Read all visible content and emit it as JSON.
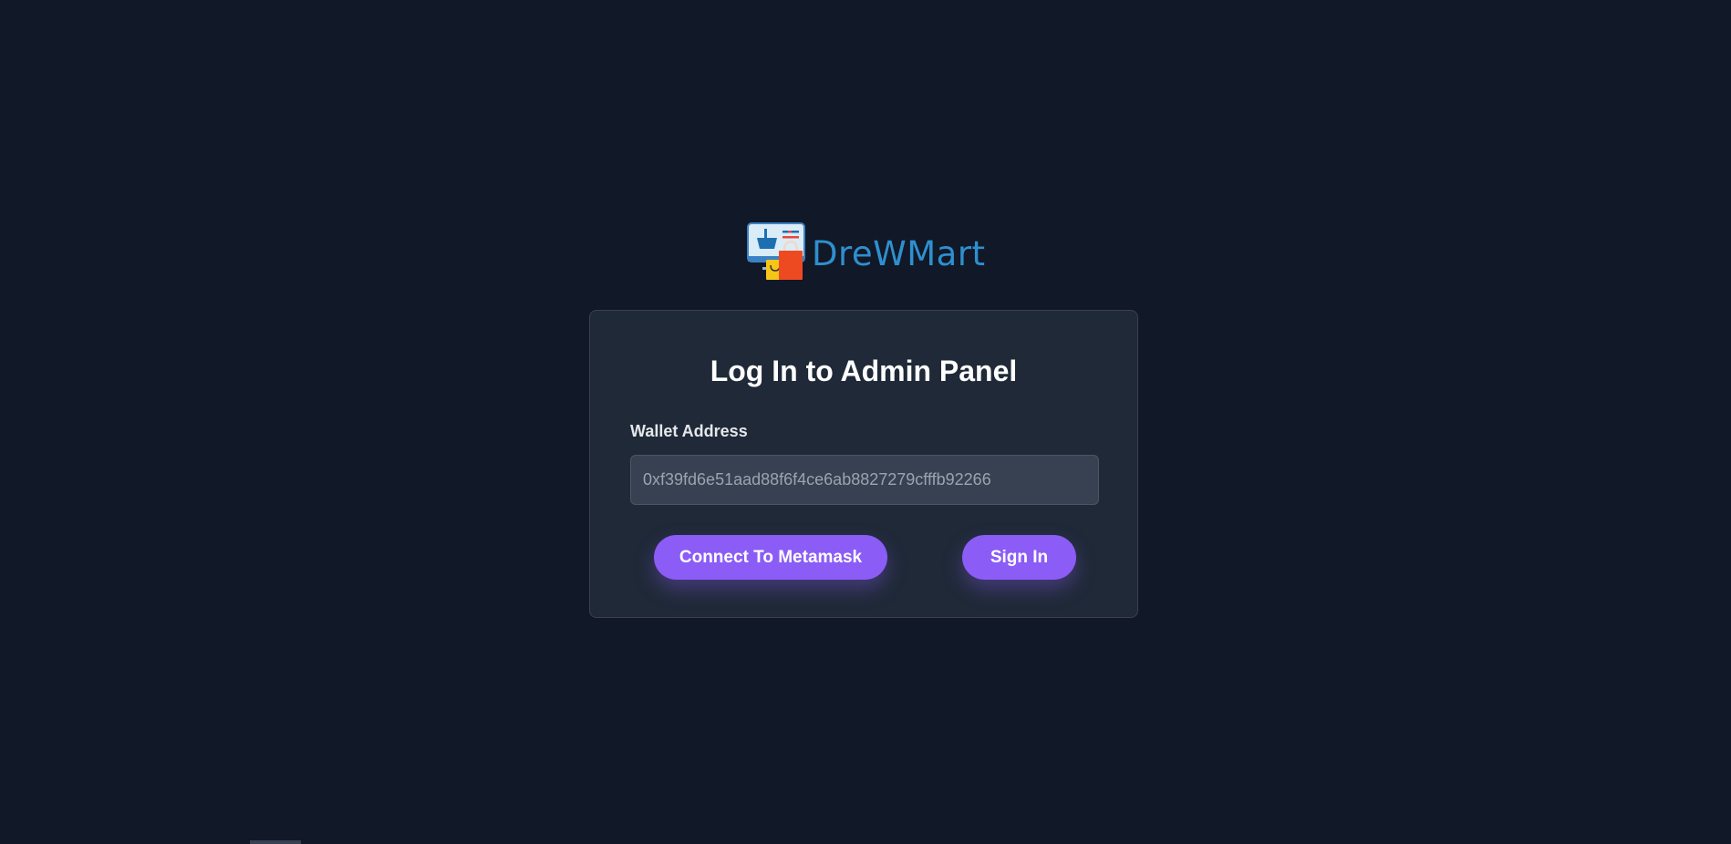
{
  "brand": {
    "name": "DreWMart",
    "logo_icon": "shopping-monitor-bags-icon",
    "name_color": "#2f8fcf"
  },
  "login": {
    "title": "Log In to Admin Panel",
    "wallet_label": "Wallet Address",
    "wallet_value": "",
    "wallet_placeholder": "0xf39fd6e51aad88f6f4ce6ab8827279cfffb92266",
    "connect_label": "Connect To Metamask",
    "signin_label": "Sign In"
  },
  "colors": {
    "background": "#111827",
    "card": "#1f2937",
    "input": "#374151",
    "accent": "#8b5cf6"
  }
}
